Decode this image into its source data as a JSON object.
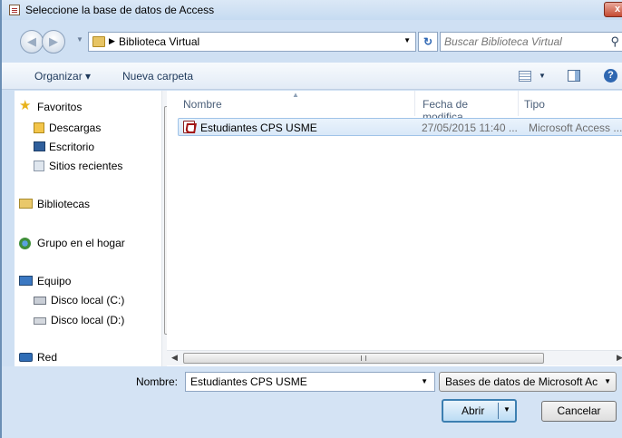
{
  "window": {
    "title": "Seleccione la base de datos de Access",
    "close_label": "x"
  },
  "address": {
    "crumb": "Biblioteca Virtual",
    "search_placeholder": "Buscar Biblioteca Virtual"
  },
  "toolbar": {
    "organize_label": "Organizar ▾",
    "new_folder_label": "Nueva carpeta"
  },
  "nav": {
    "items": [
      {
        "label": "Favoritos",
        "icon": "star-icon"
      },
      {
        "label": "Descargas",
        "icon": "downloads-icon"
      },
      {
        "label": "Escritorio",
        "icon": "desktop-icon"
      },
      {
        "label": "Sitios recientes",
        "icon": "recent-icon"
      },
      {
        "label": "Bibliotecas",
        "icon": "library-icon"
      },
      {
        "label": "Grupo en el hogar",
        "icon": "homegroup-icon"
      },
      {
        "label": "Equipo",
        "icon": "computer-icon"
      },
      {
        "label": "Disco local (C:)",
        "icon": "drive-icon"
      },
      {
        "label": "Disco local (D:)",
        "icon": "drive-icon"
      },
      {
        "label": "Red",
        "icon": "network-icon"
      }
    ]
  },
  "files": {
    "columns": [
      "Nombre",
      "Fecha de modifica...",
      "Tipo"
    ],
    "rows": [
      {
        "name": "Estudiantes CPS USME",
        "date": "27/05/2015 11:40 ...",
        "type": "Microsoft Access ..."
      }
    ]
  },
  "footer": {
    "name_label": "Nombre:",
    "name_value": "Estudiantes CPS USME",
    "filetype": "Bases de datos de Microsoft Ac",
    "open_label": "Abrir",
    "cancel_label": "Cancelar"
  },
  "colors": {
    "accent": "#3c7fb1",
    "selection": "#d9e8f8",
    "close": "#c44b33"
  }
}
